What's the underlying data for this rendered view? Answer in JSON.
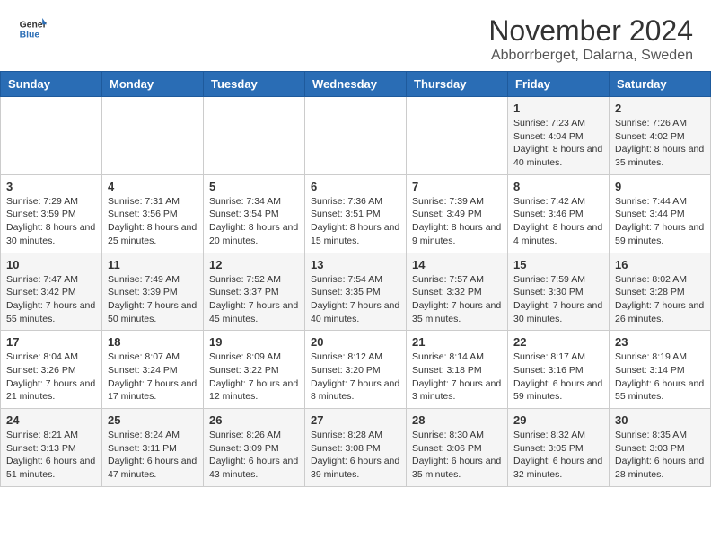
{
  "header": {
    "logo_line1": "General",
    "logo_line2": "Blue",
    "month_title": "November 2024",
    "location": "Abborrberget, Dalarna, Sweden"
  },
  "weekdays": [
    "Sunday",
    "Monday",
    "Tuesday",
    "Wednesday",
    "Thursday",
    "Friday",
    "Saturday"
  ],
  "weeks": [
    [
      {
        "day": "",
        "info": ""
      },
      {
        "day": "",
        "info": ""
      },
      {
        "day": "",
        "info": ""
      },
      {
        "day": "",
        "info": ""
      },
      {
        "day": "",
        "info": ""
      },
      {
        "day": "1",
        "info": "Sunrise: 7:23 AM\nSunset: 4:04 PM\nDaylight: 8 hours and 40 minutes."
      },
      {
        "day": "2",
        "info": "Sunrise: 7:26 AM\nSunset: 4:02 PM\nDaylight: 8 hours and 35 minutes."
      }
    ],
    [
      {
        "day": "3",
        "info": "Sunrise: 7:29 AM\nSunset: 3:59 PM\nDaylight: 8 hours and 30 minutes."
      },
      {
        "day": "4",
        "info": "Sunrise: 7:31 AM\nSunset: 3:56 PM\nDaylight: 8 hours and 25 minutes."
      },
      {
        "day": "5",
        "info": "Sunrise: 7:34 AM\nSunset: 3:54 PM\nDaylight: 8 hours and 20 minutes."
      },
      {
        "day": "6",
        "info": "Sunrise: 7:36 AM\nSunset: 3:51 PM\nDaylight: 8 hours and 15 minutes."
      },
      {
        "day": "7",
        "info": "Sunrise: 7:39 AM\nSunset: 3:49 PM\nDaylight: 8 hours and 9 minutes."
      },
      {
        "day": "8",
        "info": "Sunrise: 7:42 AM\nSunset: 3:46 PM\nDaylight: 8 hours and 4 minutes."
      },
      {
        "day": "9",
        "info": "Sunrise: 7:44 AM\nSunset: 3:44 PM\nDaylight: 7 hours and 59 minutes."
      }
    ],
    [
      {
        "day": "10",
        "info": "Sunrise: 7:47 AM\nSunset: 3:42 PM\nDaylight: 7 hours and 55 minutes."
      },
      {
        "day": "11",
        "info": "Sunrise: 7:49 AM\nSunset: 3:39 PM\nDaylight: 7 hours and 50 minutes."
      },
      {
        "day": "12",
        "info": "Sunrise: 7:52 AM\nSunset: 3:37 PM\nDaylight: 7 hours and 45 minutes."
      },
      {
        "day": "13",
        "info": "Sunrise: 7:54 AM\nSunset: 3:35 PM\nDaylight: 7 hours and 40 minutes."
      },
      {
        "day": "14",
        "info": "Sunrise: 7:57 AM\nSunset: 3:32 PM\nDaylight: 7 hours and 35 minutes."
      },
      {
        "day": "15",
        "info": "Sunrise: 7:59 AM\nSunset: 3:30 PM\nDaylight: 7 hours and 30 minutes."
      },
      {
        "day": "16",
        "info": "Sunrise: 8:02 AM\nSunset: 3:28 PM\nDaylight: 7 hours and 26 minutes."
      }
    ],
    [
      {
        "day": "17",
        "info": "Sunrise: 8:04 AM\nSunset: 3:26 PM\nDaylight: 7 hours and 21 minutes."
      },
      {
        "day": "18",
        "info": "Sunrise: 8:07 AM\nSunset: 3:24 PM\nDaylight: 7 hours and 17 minutes."
      },
      {
        "day": "19",
        "info": "Sunrise: 8:09 AM\nSunset: 3:22 PM\nDaylight: 7 hours and 12 minutes."
      },
      {
        "day": "20",
        "info": "Sunrise: 8:12 AM\nSunset: 3:20 PM\nDaylight: 7 hours and 8 minutes."
      },
      {
        "day": "21",
        "info": "Sunrise: 8:14 AM\nSunset: 3:18 PM\nDaylight: 7 hours and 3 minutes."
      },
      {
        "day": "22",
        "info": "Sunrise: 8:17 AM\nSunset: 3:16 PM\nDaylight: 6 hours and 59 minutes."
      },
      {
        "day": "23",
        "info": "Sunrise: 8:19 AM\nSunset: 3:14 PM\nDaylight: 6 hours and 55 minutes."
      }
    ],
    [
      {
        "day": "24",
        "info": "Sunrise: 8:21 AM\nSunset: 3:13 PM\nDaylight: 6 hours and 51 minutes."
      },
      {
        "day": "25",
        "info": "Sunrise: 8:24 AM\nSunset: 3:11 PM\nDaylight: 6 hours and 47 minutes."
      },
      {
        "day": "26",
        "info": "Sunrise: 8:26 AM\nSunset: 3:09 PM\nDaylight: 6 hours and 43 minutes."
      },
      {
        "day": "27",
        "info": "Sunrise: 8:28 AM\nSunset: 3:08 PM\nDaylight: 6 hours and 39 minutes."
      },
      {
        "day": "28",
        "info": "Sunrise: 8:30 AM\nSunset: 3:06 PM\nDaylight: 6 hours and 35 minutes."
      },
      {
        "day": "29",
        "info": "Sunrise: 8:32 AM\nSunset: 3:05 PM\nDaylight: 6 hours and 32 minutes."
      },
      {
        "day": "30",
        "info": "Sunrise: 8:35 AM\nSunset: 3:03 PM\nDaylight: 6 hours and 28 minutes."
      }
    ]
  ]
}
